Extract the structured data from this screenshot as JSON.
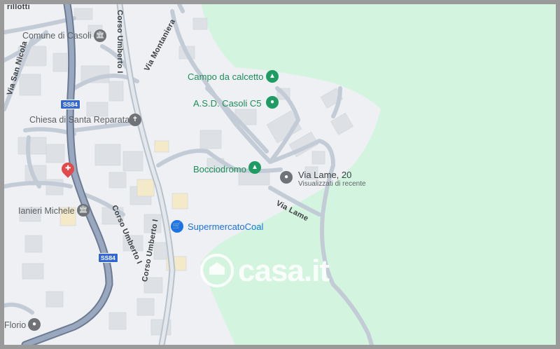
{
  "labels": {
    "comune": "Comune di Casoli",
    "chiesa": "Chiesa di Santa Reparata",
    "ianieri": "Ianieri Michele",
    "florio": "Florio",
    "campo": "Campo da calcetto",
    "asd": "A.S.D. Casoli C5",
    "bocciodromo": "Bocciodromo",
    "via_lame_address": "Via Lame, 20",
    "visualizzati": "Visualizzati di recente",
    "supermercato": "SupermercatoCoal"
  },
  "roads": {
    "corso_umberto_top": "Corso Umberto I",
    "corso_umberto_mid": "Corso Umberto I",
    "corso_umberto_bottom": "Corso Umberto I",
    "via_montaniera": "Via Montaniera",
    "via_san_nicola": "Via San Nicola",
    "via_lame": "Via Lame",
    "ss84_a": "SS84",
    "ss84_b": "SS84",
    "top_left": "rillotti"
  },
  "watermark": "casa.it",
  "colors": {
    "green_area": "#d3f5df",
    "map_bg": "#eef0f3",
    "highway": "#8a9ab5",
    "road": "#c3ccd6",
    "building": "#dde1e6",
    "label_green": "#1e8e5a",
    "pin_blue": "#1a73e8",
    "pin_red": "#e04a4a"
  },
  "icons": {
    "comune": "government-building-icon",
    "chiesa": "church-icon",
    "ianieri": "bank-icon",
    "florio": "place-pin-icon",
    "campo": "park-tree-icon",
    "asd": "sports-pin-icon",
    "bocciodromo": "park-tree-icon",
    "via_lame": "location-pin-icon",
    "supermercato": "shopping-cart-icon",
    "hospital": "hospital-icon"
  }
}
